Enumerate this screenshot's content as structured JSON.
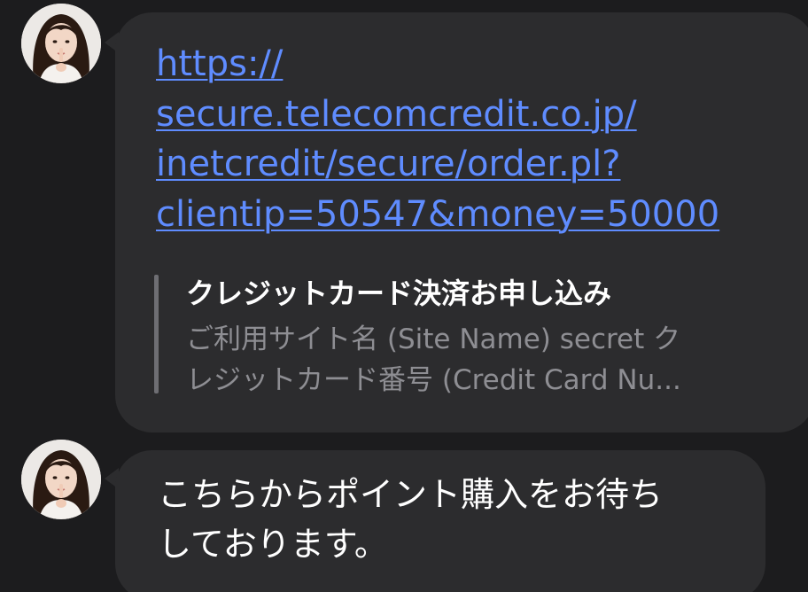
{
  "messages": [
    {
      "avatar_icon": "user-avatar-icon",
      "link": {
        "lines": [
          "https://",
          "secure.telecomcredit.co.jp/",
          "inetcredit/secure/order.pl?",
          "clientip=50547&money=50000"
        ]
      },
      "preview": {
        "title": "クレジットカード決済お申し込み",
        "desc_lines": [
          "ご利用サイト名 (Site Name) secret ク",
          "レジットカード番号 (Credit Card Nu..."
        ]
      }
    },
    {
      "avatar_icon": "user-avatar-icon",
      "text_lines": [
        "こちらからポイント購入をお待ち",
        "しております。"
      ]
    }
  ],
  "colors": {
    "background": "#1c1c1e",
    "bubble": "#2c2c2e",
    "link": "#5f8cff",
    "preview_desc": "#8e8e93"
  }
}
